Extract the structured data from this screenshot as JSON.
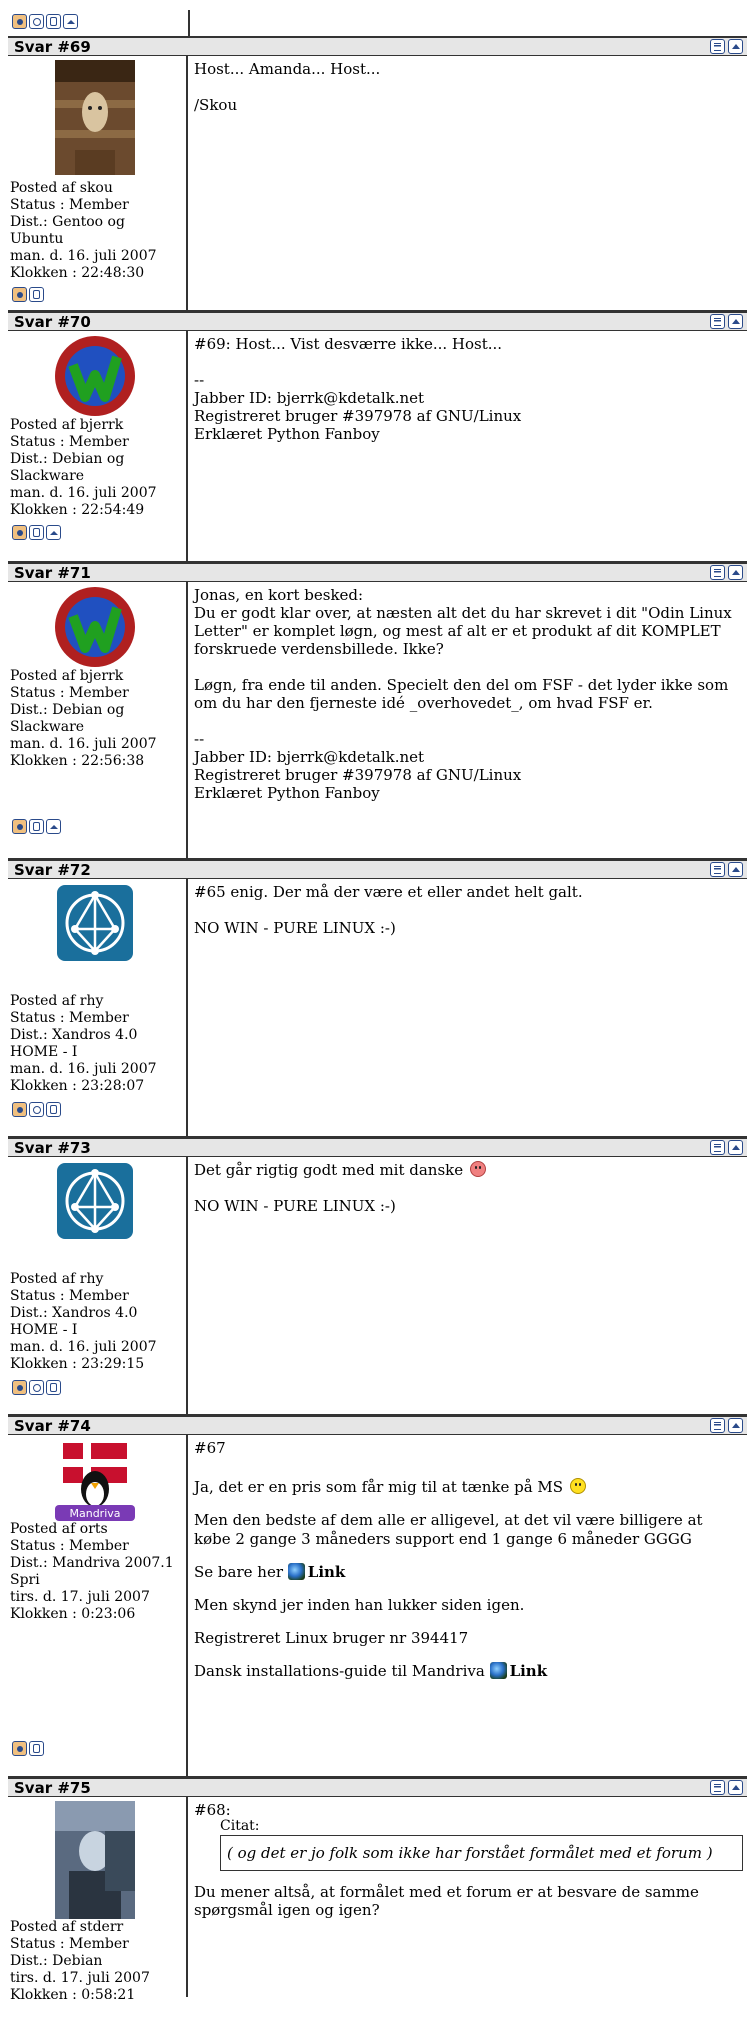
{
  "posts": [
    {
      "number": "Svar #69",
      "author_posted": "Posted af skou",
      "status": "Status : Member",
      "dist": [
        "Dist.: Gentoo og",
        "Ubuntu"
      ],
      "date": "man. d. 16. juli 2007",
      "time": "Klokken : 22:48:30",
      "avatar": "barn-animal-photo",
      "content": [
        "Host... Amanda... Host...",
        "/Skou"
      ]
    },
    {
      "number": "Svar #70",
      "author_posted": "Posted af bjerrk",
      "status": "Status : Member",
      "dist": [
        "Dist.: Debian og",
        "Slackware"
      ],
      "date": "man. d. 16. juli 2007",
      "time": "Klokken : 22:54:49",
      "avatar": "w-logo",
      "content": [
        "#69: Host... Vist desværre ikke... Host..."
      ],
      "signature": [
        "--",
        "Jabber ID: bjerrk@kdetalk.net",
        "Registreret bruger #397978 af GNU/Linux",
        "Erklæret Python Fanboy"
      ]
    },
    {
      "number": "Svar #71",
      "author_posted": "Posted af bjerrk",
      "status": "Status : Member",
      "dist": [
        "Dist.: Debian og",
        "Slackware"
      ],
      "date": "man. d. 16. juli 2007",
      "time": "Klokken : 22:56:38",
      "avatar": "w-logo",
      "content": [
        "Jonas, en kort besked:",
        "Du er godt klar over, at næsten alt det du har skrevet i dit \"Odin Linux Letter\" er komplet løgn, og mest af alt er et produkt af dit KOMPLET forskruede verdensbillede. Ikke?",
        "Løgn, fra ende til anden. Specielt den del om FSF - det lyder ikke som om du har den fjerneste idé _overhovedet_, om hvad FSF er."
      ],
      "signature": [
        "--",
        "Jabber ID: bjerrk@kdetalk.net",
        "Registreret bruger #397978 af GNU/Linux",
        "Erklæret Python Fanboy"
      ]
    },
    {
      "number": "Svar #72",
      "author_posted": "Posted af rhy",
      "status": "Status : Member",
      "dist": [
        "Dist.: Xandros 4.0",
        "HOME - I"
      ],
      "date": "man. d. 16. juli 2007",
      "time": "Klokken : 23:28:07",
      "avatar": "network-logo",
      "content": [
        "#65 enig. Der må der være et eller andet helt galt.",
        "NO WIN - PURE LINUX :-)"
      ]
    },
    {
      "number": "Svar #73",
      "author_posted": "Posted af rhy",
      "status": "Status : Member",
      "dist": [
        "Dist.: Xandros 4.0",
        "HOME - I"
      ],
      "date": "man. d. 16. juli 2007",
      "time": "Klokken : 23:29:15",
      "avatar": "network-logo",
      "content": [
        "Det går rigtig godt med mit danske",
        "NO WIN - PURE LINUX :-)"
      ]
    },
    {
      "number": "Svar #74",
      "author_posted": "Posted af orts",
      "status": "Status : Member",
      "dist": [
        "Dist.: Mandriva 2007.1",
        "Spri"
      ],
      "date": "tirs. d. 17. juli 2007",
      "time": "Klokken : 0:23:06",
      "avatar": "tux-mandriva",
      "avatar_text": "Mandriva",
      "content": [
        "#67",
        "Ja, det er en pris som får mig til at tænke på MS",
        "Men den bedste af dem alle er alligevel, at det vil være billigere at købe 2 gange 3 måneders support end 1 gange 6 måneder GGGG",
        "Se bare her",
        "Men skynd jer inden han lukker siden igen.",
        "Registreret Linux bruger nr 394417",
        "Dansk installations-guide til Mandriva"
      ],
      "link_label": "Link"
    },
    {
      "number": "Svar #75",
      "author_posted": "Posted af stderr",
      "status": "Status : Member",
      "dist": [
        "Dist.: Debian"
      ],
      "date": "tirs. d. 17. juli 2007",
      "time": "Klokken : 0:58:21",
      "avatar": "person-photo",
      "content": [
        "#68:",
        "Du mener altså, at formålet med et forum er at besvare de samme spørgsmål igen og igen?"
      ],
      "quote_label": "Citat:",
      "quote_text": "( og det er jo folk som ikke har forstået formålet med et forum )"
    }
  ],
  "colors": {
    "header_bg": "#e6e6e6",
    "border": "#333333",
    "icon_blue": "#2a4a8a"
  }
}
